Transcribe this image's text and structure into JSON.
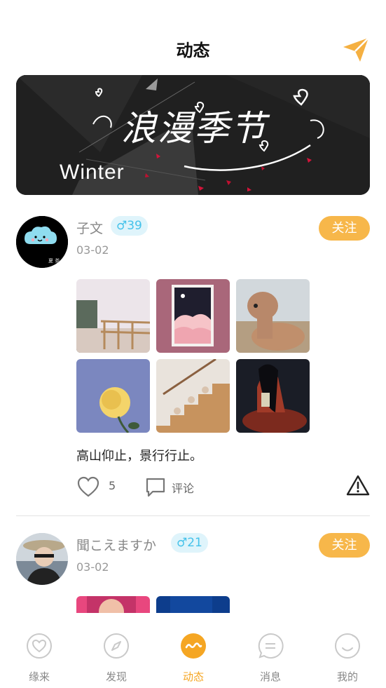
{
  "header": {
    "title": "动态",
    "send_icon": "paper-plane-icon",
    "accent_color": "#f5b041"
  },
  "banner": {
    "title": "浪漫季节",
    "subtitle": "Winter"
  },
  "posts": [
    {
      "username": "子文",
      "gender_age": "♂39",
      "date": "03-02",
      "follow_label": "关注",
      "text": "高山仰止，景行行止。",
      "likes": "5",
      "comment_label": "评论"
    },
    {
      "username": "聞こえますか",
      "gender_age": "♂21",
      "date": "03-02",
      "follow_label": "关注"
    }
  ],
  "tabs": [
    {
      "label": "缘来",
      "icon": "heart-icon"
    },
    {
      "label": "发现",
      "icon": "compass-icon"
    },
    {
      "label": "动态",
      "icon": "moments-icon",
      "active": true
    },
    {
      "label": "消息",
      "icon": "message-icon"
    },
    {
      "label": "我的",
      "icon": "profile-icon"
    }
  ],
  "colors": {
    "follow_button": "#f7b74a",
    "badge_text": "#45c2ea",
    "badge_bg": "#dff4fb",
    "tab_active": "#f5a623"
  }
}
